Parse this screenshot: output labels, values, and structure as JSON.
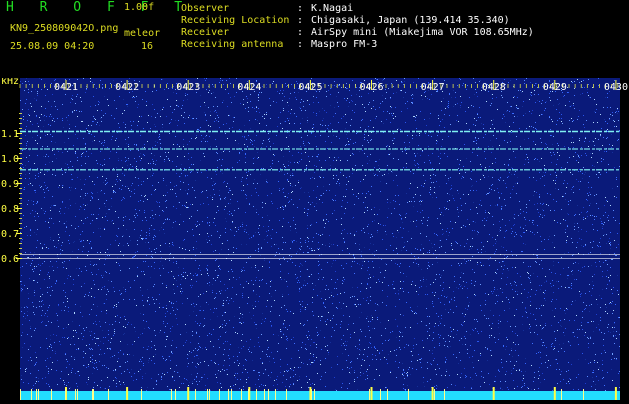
{
  "header": {
    "title": "H R O F F T",
    "version": "1.00f",
    "filename": "KN9_250809042O.png",
    "timestamp": "25.08.09 04:20",
    "meteor_label": "meleor",
    "meteor_count": "16"
  },
  "info": {
    "rows": [
      {
        "label": "Observer",
        "value": "K.Nagai"
      },
      {
        "label": "Receiving Location",
        "value": "Chigasaki, Japan (139.414 35.340)"
      },
      {
        "label": "Receiver",
        "value": "AirSpy mini (Miakejima VOR 108.65MHz)"
      },
      {
        "label": "Receiving antenna",
        "value": "Maspro FM-3"
      }
    ]
  },
  "colors": {
    "title": "#22dd22",
    "filename": "#dddd22",
    "label": "#dddd22",
    "value": "#ffffff",
    "axis": "#ffff44",
    "noise_bg": "#0a1a7a",
    "cyan": "#22ffff"
  },
  "plot": {
    "y_unit": "kHz",
    "y_ticks": [
      "1.1",
      "1.0",
      "0.9",
      "0.8",
      "0.7",
      "0.6"
    ],
    "y_values": [
      1.1,
      1.0,
      0.9,
      0.8,
      0.7,
      0.6
    ],
    "time_ticks": [
      "0421",
      "0422",
      "0423",
      "0424",
      "0425",
      "0426",
      "0427",
      "0428",
      "0429",
      "0430"
    ],
    "carrier_lines_khz": [
      1.108,
      1.038,
      0.955
    ],
    "carrier_intensity": [
      1.0,
      0.75,
      0.8
    ],
    "reference_lines_khz": [
      0.616,
      0.6
    ]
  }
}
